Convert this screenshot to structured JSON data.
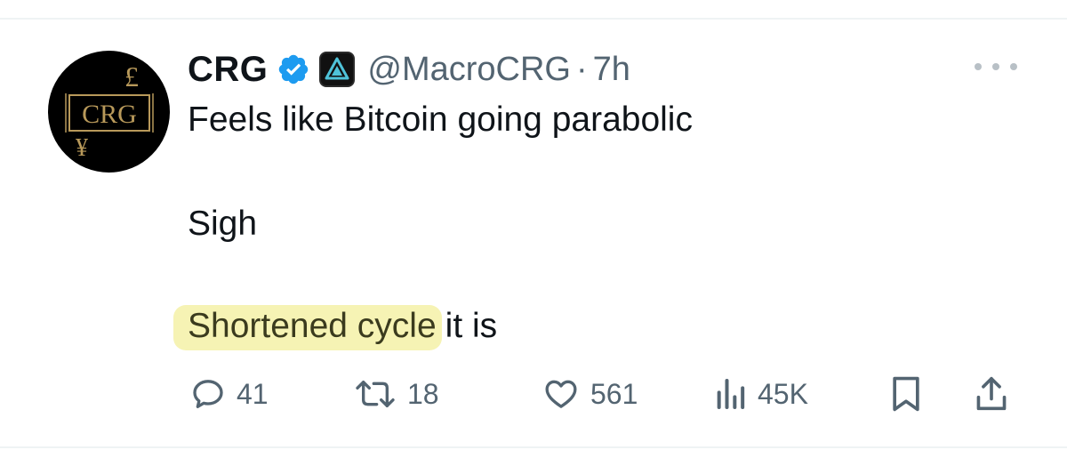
{
  "tweet": {
    "author": {
      "display_name": "CRG",
      "handle": "@MacroCRG",
      "avatar_text": "CRG",
      "avatar_symbols": {
        "top": "£",
        "bottom": "¥"
      }
    },
    "separator": "·",
    "time": "7h",
    "lines": {
      "line1": "Feels like Bitcoin going parabolic",
      "line2": "Sigh",
      "line3_highlighted": "Shortened cycle",
      "line3_rest": "it is"
    }
  },
  "actions": {
    "replies": "41",
    "retweets": "18",
    "likes": "561",
    "views": "45K"
  },
  "icons": {
    "verified": "verified-badge-icon",
    "affiliate": "affiliate-logo-icon",
    "more": "more-options-icon",
    "reply": "reply-icon",
    "retweet": "retweet-icon",
    "like": "heart-icon",
    "views": "views-chart-icon",
    "bookmark": "bookmark-icon",
    "share": "share-icon"
  },
  "colors": {
    "verified_blue": "#1d9bf0",
    "secondary_text": "#536471",
    "highlight": "#f6f3b4",
    "avatar_gold": "#b8995a"
  }
}
